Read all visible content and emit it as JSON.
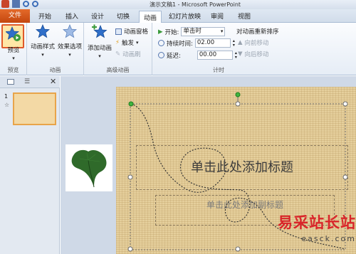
{
  "window": {
    "title": "演示文稿1 - Microsoft PowerPoint"
  },
  "tabs": [
    "文件",
    "开始",
    "插入",
    "设计",
    "切换",
    "动画",
    "幻灯片放映",
    "审阅",
    "视图"
  ],
  "ribbon": {
    "preview": {
      "label": "预览",
      "group": "预览"
    },
    "animation": {
      "style_label": "动画样式",
      "effect_label": "效果选项",
      "group": "动画"
    },
    "advanced": {
      "add_label": "添加动画",
      "pane_label": "动画窗格",
      "trigger_label": "触发",
      "painter_label": "动画刷",
      "group": "高级动画"
    },
    "timing": {
      "start_label": "开始:",
      "start_value": "单击时",
      "duration_label": "持续时间:",
      "duration_value": "02.00",
      "delay_label": "延迟:",
      "delay_value": "00.00",
      "reorder_label": "对动画重新排序",
      "forward_label": "向前移动",
      "backward_label": "向后移动",
      "group": "计时"
    }
  },
  "slides_panel": {
    "slide_number": "1",
    "slide_marker": "☆"
  },
  "slide": {
    "title_placeholder": "单击此处添加标题",
    "subtitle_placeholder": "单击此处添加副标题"
  },
  "watermark": {
    "main": "易采站长站",
    "sub": "easck.com"
  },
  "colors": {
    "file_tab": "#d0561a",
    "accent_blue": "#2f6fc9",
    "slide_bg": "#e5cf9c",
    "watermark_red": "#d9252a"
  }
}
